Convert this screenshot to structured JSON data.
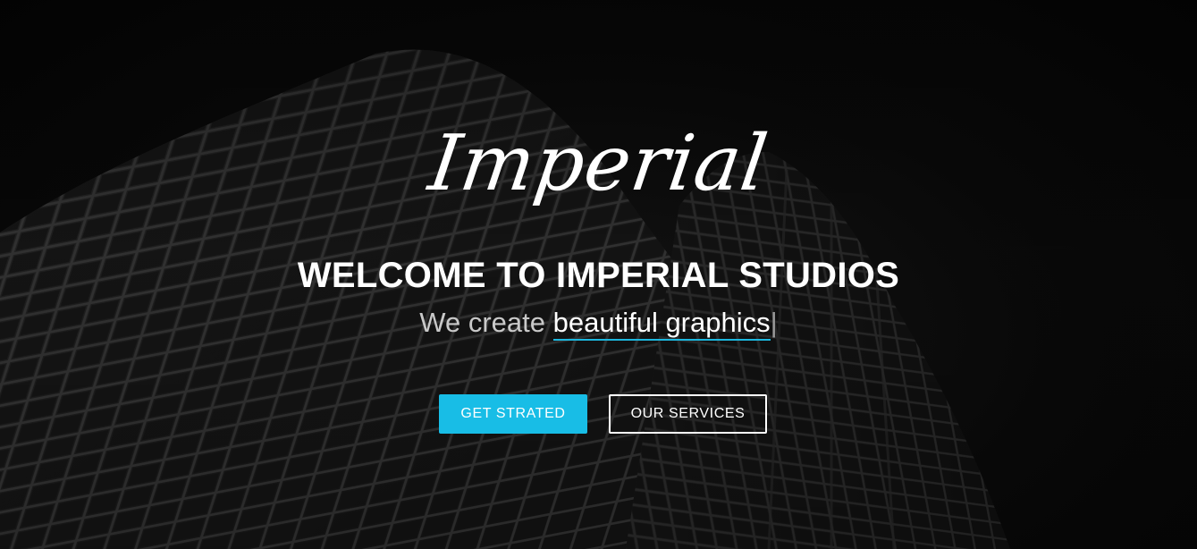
{
  "hero": {
    "logo_text": "Imperial",
    "headline": "WELCOME TO IMPERIAL STUDIOS",
    "tagline_prefix": "We create ",
    "tagline_typed": "beautiful graphics",
    "tagline_cursor": "|",
    "primary_button": "GET STRATED",
    "secondary_button": "OUR SERVICES"
  },
  "colors": {
    "accent": "#18bde6",
    "background": "#050505",
    "text": "#ffffff"
  }
}
